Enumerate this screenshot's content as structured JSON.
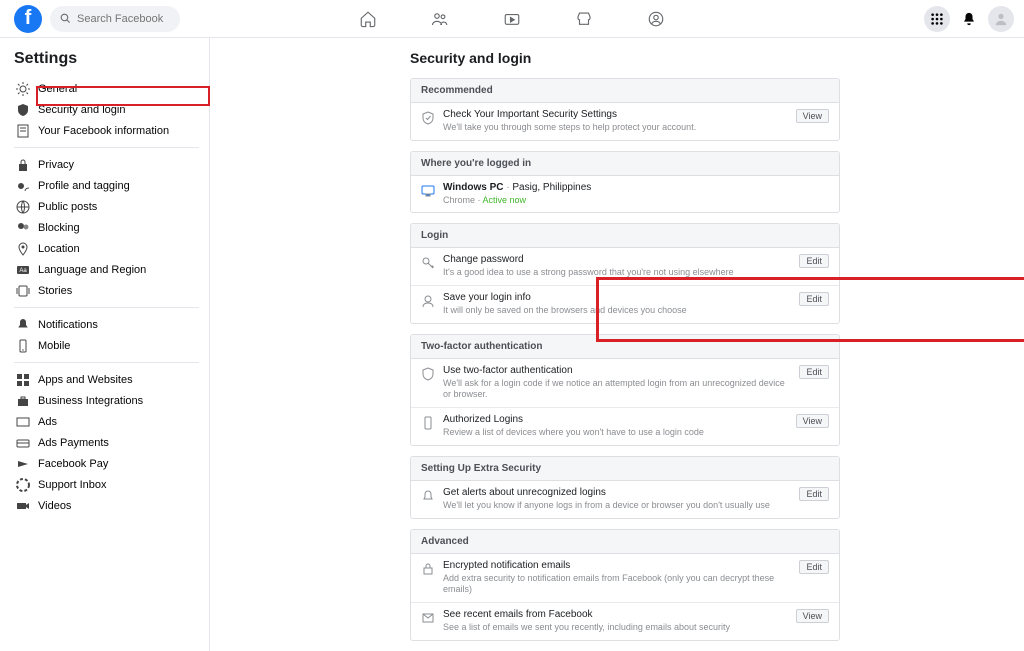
{
  "header": {
    "search_placeholder": "Search Facebook"
  },
  "sidebar": {
    "title": "Settings",
    "groups": [
      [
        "General",
        "Security and login",
        "Your Facebook information"
      ],
      [
        "Privacy",
        "Profile and tagging",
        "Public posts",
        "Blocking",
        "Location",
        "Language and Region",
        "Stories"
      ],
      [
        "Notifications",
        "Mobile"
      ],
      [
        "Apps and Websites",
        "Business Integrations",
        "Ads",
        "Ads Payments",
        "Facebook Pay",
        "Support Inbox",
        "Videos"
      ]
    ]
  },
  "main": {
    "title": "Security and login",
    "sections": [
      {
        "header": "Recommended",
        "rows": [
          {
            "icon": "check-shield",
            "title": "Check Your Important Security Settings",
            "sub": "We'll take you through some steps to help protect your account.",
            "action": "View"
          }
        ]
      },
      {
        "header": "Where you're logged in",
        "rows": [
          {
            "icon": "monitor",
            "title_html": {
              "device": "Windows PC",
              "sep": " · ",
              "loc": "Pasig, Philippines"
            },
            "sub_html": {
              "browser": "Chrome",
              "sep": " · ",
              "status": "Active now"
            }
          }
        ]
      },
      {
        "header": "Login",
        "rows": [
          {
            "icon": "key",
            "title": "Change password",
            "sub": "It's a good idea to use a strong password that you're not using elsewhere",
            "action": "Edit"
          },
          {
            "icon": "person",
            "title": "Save your login info",
            "sub": "It will only be saved on the browsers and devices you choose",
            "action": "Edit"
          }
        ]
      },
      {
        "header": "Two-factor authentication",
        "rows": [
          {
            "icon": "shield",
            "title": "Use two-factor authentication",
            "sub": "We'll ask for a login code if we notice an attempted login from an unrecognized device or browser.",
            "action": "Edit"
          },
          {
            "icon": "phone",
            "title": "Authorized Logins",
            "sub": "Review a list of devices where you won't have to use a login code",
            "action": "View"
          }
        ]
      },
      {
        "header": "Setting Up Extra Security",
        "rows": [
          {
            "icon": "bell",
            "title": "Get alerts about unrecognized logins",
            "sub": "We'll let you know if anyone logs in from a device or browser you don't usually use",
            "action": "Edit"
          }
        ]
      },
      {
        "header": "Advanced",
        "rows": [
          {
            "icon": "lock",
            "title": "Encrypted notification emails",
            "sub": "Add extra security to notification emails from Facebook (only you can decrypt these emails)",
            "action": "Edit"
          },
          {
            "icon": "mail",
            "title": "See recent emails from Facebook",
            "sub": "See a list of emails we sent you recently, including emails about security",
            "action": "View"
          }
        ]
      }
    ]
  }
}
